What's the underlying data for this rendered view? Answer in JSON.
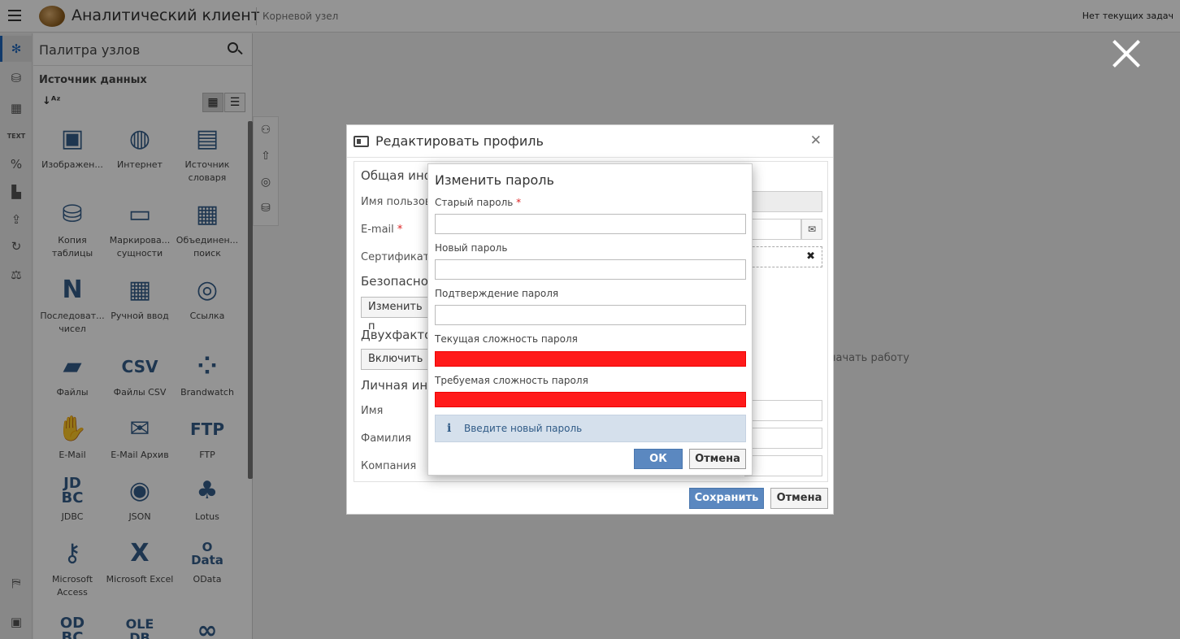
{
  "header": {
    "app_title": "Аналитический клиент",
    "root_node": "Корневой узел",
    "tasks_status": "Нет текущих задач"
  },
  "rail": {
    "items": [
      {
        "icon": "snowflake-icon",
        "glyph": "✻",
        "active": true
      },
      {
        "icon": "database-icon",
        "glyph": "⛁",
        "active": false
      },
      {
        "icon": "table-icon",
        "glyph": "▦",
        "active": false
      },
      {
        "icon": "text-icon",
        "glyph": "TEXT",
        "active": false
      },
      {
        "icon": "percent-icon",
        "glyph": "%",
        "active": false
      },
      {
        "icon": "bar-chart-icon",
        "glyph": "▙",
        "active": false
      },
      {
        "icon": "export-icon",
        "glyph": "⇪",
        "active": false
      },
      {
        "icon": "refresh-icon",
        "glyph": "↻",
        "active": false
      },
      {
        "icon": "scales-icon",
        "glyph": "⚖",
        "active": false
      }
    ],
    "bottom": [
      {
        "icon": "map-icon",
        "glyph": "⛿"
      },
      {
        "icon": "presentation-icon",
        "glyph": "▣"
      }
    ]
  },
  "palette": {
    "title": "Палитра узлов",
    "section": "Источник данных",
    "items": [
      {
        "label": "Изображен...",
        "icon": "image-icon",
        "glyph": "▣"
      },
      {
        "label": "Интернет",
        "icon": "globe-icon",
        "glyph": "◍"
      },
      {
        "label": "Источник словаря",
        "icon": "books-icon",
        "glyph": "▤"
      },
      {
        "label": "Копия таблицы",
        "icon": "db-copy-icon",
        "glyph": "⛁"
      },
      {
        "label": "Маркирова... сущности",
        "icon": "entity-icon",
        "glyph": "▭"
      },
      {
        "label": "Объединен... поиск",
        "icon": "merge-search-icon",
        "glyph": "▦"
      },
      {
        "label": "Последоват... чисел",
        "icon": "sequence-icon",
        "glyph": "N"
      },
      {
        "label": "Ручной ввод",
        "icon": "manual-input-icon",
        "glyph": "▦"
      },
      {
        "label": "Ссылка",
        "icon": "link-icon",
        "glyph": "◎"
      },
      {
        "label": "Файлы",
        "icon": "folder-icon",
        "glyph": "▰"
      },
      {
        "label": "Файлы CSV",
        "icon": "csv-icon",
        "glyph": "CSV"
      },
      {
        "label": "Brandwatch",
        "icon": "brandwatch-icon",
        "glyph": "⁘"
      },
      {
        "label": "E-Mail",
        "icon": "email-hand-icon",
        "glyph": "✋"
      },
      {
        "label": "E-Mail Архив",
        "icon": "envelope-icon",
        "glyph": "✉"
      },
      {
        "label": "FTP",
        "icon": "ftp-icon",
        "glyph": "FTP"
      },
      {
        "label": "JDBC",
        "icon": "jdbc-icon",
        "glyph": "JD\nBC"
      },
      {
        "label": "JSON",
        "icon": "json-icon",
        "glyph": "◉"
      },
      {
        "label": "Lotus",
        "icon": "lotus-icon",
        "glyph": "♣"
      },
      {
        "label": "Microsoft Access",
        "icon": "key-icon",
        "glyph": "⚷"
      },
      {
        "label": "Microsoft Excel",
        "icon": "excel-icon",
        "glyph": "X"
      },
      {
        "label": "OData",
        "icon": "odata-icon",
        "glyph": "O\nData"
      },
      {
        "label": "",
        "icon": "odbc-icon",
        "glyph": "OD\nBC"
      },
      {
        "label": "",
        "icon": "oledb-icon",
        "glyph": "OLE\nDB"
      },
      {
        "label": "",
        "icon": "loops-icon",
        "glyph": "∞"
      }
    ]
  },
  "side_tools": [
    {
      "icon": "circles-icon",
      "glyph": "⚇"
    },
    {
      "icon": "upload-folder-icon",
      "glyph": "⇧"
    },
    {
      "icon": "target-icon",
      "glyph": "◎"
    },
    {
      "icon": "db-stack-icon",
      "glyph": "⛁"
    }
  ],
  "background_hint": "начать работу",
  "profile": {
    "title": "Редактировать профиль",
    "section_general": "Общая инф",
    "username_label": "Имя пользова",
    "email_label": "E-mail",
    "certificate_label": "Сертификат",
    "section_security": "Безопаснос",
    "change_password_button": "Изменить п",
    "section_2fa": "Двухфактор",
    "enable_button": "Включить",
    "section_personal": "Личная инф",
    "first_name_label": "Имя",
    "last_name_label": "Фамилия",
    "company_label": "Компания",
    "save_button": "Сохранить",
    "cancel_button": "Отмена",
    "required_mark": "*"
  },
  "change_password": {
    "title": "Изменить пароль",
    "old_password_label": "Старый пароль",
    "required_mark": "*",
    "old_password_value": "",
    "new_password_label": "Новый пароль",
    "new_password_value": "",
    "confirm_password_label": "Подтверждение пароля",
    "confirm_password_value": "",
    "current_strength_label": "Текущая сложность пароля",
    "required_strength_label": "Требуемая сложность пароля",
    "strength_color": "#ff1a1a",
    "info_text": "Введите новый пароль",
    "ok_button": "ОК",
    "cancel_button": "Отмена"
  },
  "colors": {
    "accent": "#1e64b8",
    "primary_button": "#5b88c0",
    "info_bg": "#d5e0ec",
    "strength_bad": "#ff1a1a"
  }
}
